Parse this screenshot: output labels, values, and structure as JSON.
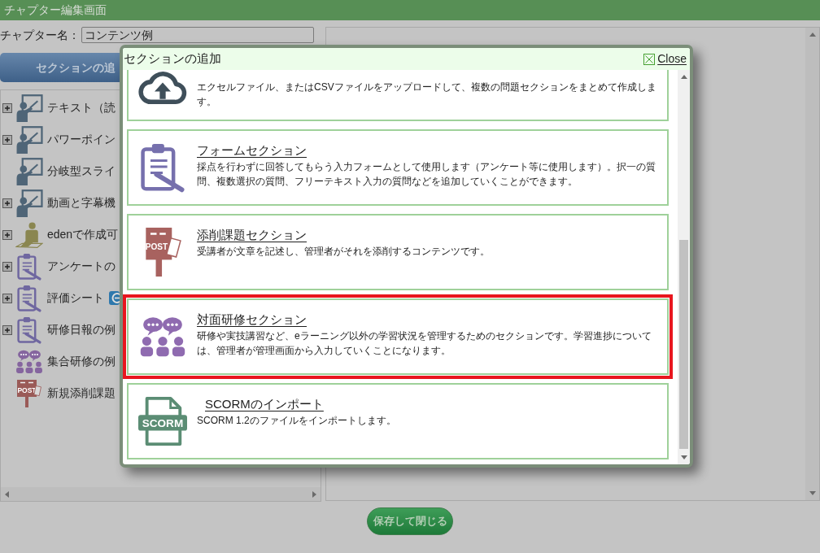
{
  "window": {
    "title": "チャプター編集画面"
  },
  "chapter_name": {
    "label": "チャプター名：",
    "value": "コンテンツ例"
  },
  "add_section_button": {
    "label": "セクションの追"
  },
  "tree": {
    "items": [
      {
        "kind": "slide",
        "label": "テキスト（読",
        "expandable": true,
        "badge": false
      },
      {
        "kind": "slide",
        "label": "パワーポイン",
        "expandable": true,
        "badge": false
      },
      {
        "kind": "slide",
        "label": "分岐型スライ",
        "expandable": false,
        "badge": false
      },
      {
        "kind": "slide",
        "label": "動画と字幕機",
        "expandable": true,
        "badge": false
      },
      {
        "kind": "eden",
        "label": "edenで作成可",
        "expandable": true,
        "badge": false
      },
      {
        "kind": "form",
        "label": "アンケートの",
        "expandable": true,
        "badge": false
      },
      {
        "kind": "form",
        "label": "評価シート",
        "expandable": true,
        "badge": true
      },
      {
        "kind": "form",
        "label": "研修日報の例",
        "expandable": true,
        "badge": false
      },
      {
        "kind": "group",
        "label": "集合研修の例",
        "expandable": false,
        "badge": false
      },
      {
        "kind": "post",
        "icon_text": "POST",
        "label": "新規添削課題",
        "expandable": false,
        "badge": false
      }
    ]
  },
  "dialog": {
    "title": "セクションの追加",
    "close": "Close",
    "options": [
      {
        "kind": "upload",
        "description": "エクセルファイル、またはCSVファイルをアップロードして、複数の問題セクションをまとめて作成します。",
        "highlighted": false
      },
      {
        "kind": "form",
        "title": "フォームセクション",
        "description": "採点を行わずに回答してもらう入力フォームとして使用します（アンケート等に使用します）。択一の質問、複数選択の質問、フリーテキスト入力の質問などを追加していくことができます。",
        "highlighted": false
      },
      {
        "kind": "post",
        "icon_text": "POST",
        "title": "添削課題セクション",
        "description": "受講者が文章を記述し、管理者がそれを添削するコンテンツです。",
        "highlighted": false
      },
      {
        "kind": "group",
        "title": "対面研修セクション",
        "description": "研修や実技講習など、eラーニング以外の学習状況を管理するためのセクションです。学習進捗については、管理者が管理画面から入力していくことになります。",
        "highlighted": true
      },
      {
        "kind": "scorm",
        "icon_text": "SCORM",
        "title": "SCORMのインポート",
        "description": "SCORM 1.2のファイルをインポートします。",
        "highlighted": false
      }
    ]
  },
  "save_button": {
    "label": "保存して閉じる"
  }
}
